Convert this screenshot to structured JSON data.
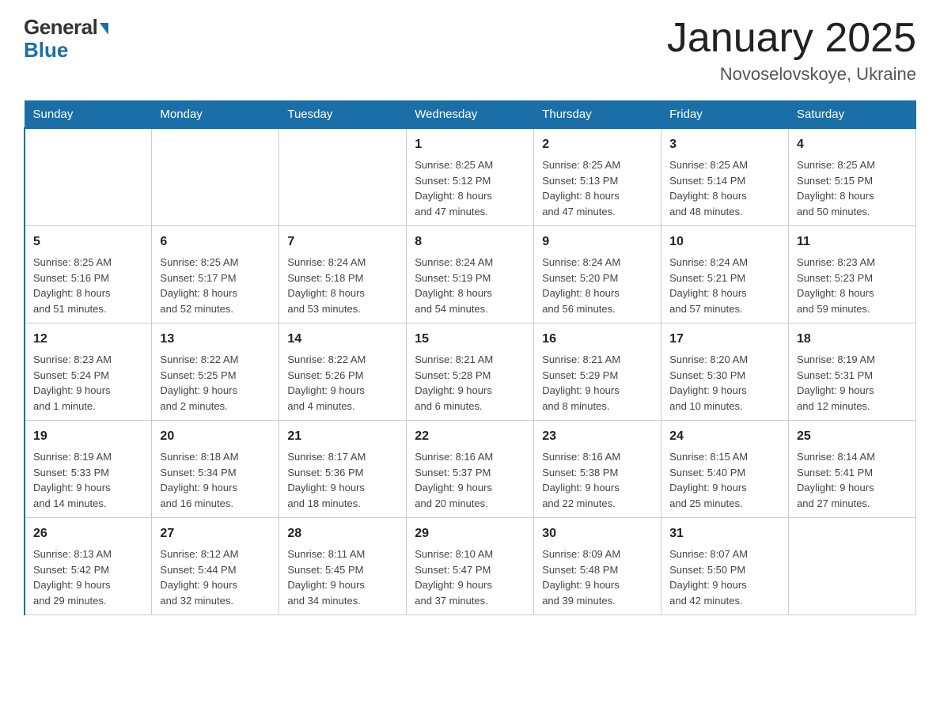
{
  "header": {
    "logo_general": "General",
    "logo_blue": "Blue",
    "title": "January 2025",
    "subtitle": "Novoselovskoye, Ukraine"
  },
  "days_of_week": [
    "Sunday",
    "Monday",
    "Tuesday",
    "Wednesday",
    "Thursday",
    "Friday",
    "Saturday"
  ],
  "weeks": [
    {
      "cells": [
        {
          "day": "",
          "info": ""
        },
        {
          "day": "",
          "info": ""
        },
        {
          "day": "",
          "info": ""
        },
        {
          "day": "1",
          "info": "Sunrise: 8:25 AM\nSunset: 5:12 PM\nDaylight: 8 hours\nand 47 minutes."
        },
        {
          "day": "2",
          "info": "Sunrise: 8:25 AM\nSunset: 5:13 PM\nDaylight: 8 hours\nand 47 minutes."
        },
        {
          "day": "3",
          "info": "Sunrise: 8:25 AM\nSunset: 5:14 PM\nDaylight: 8 hours\nand 48 minutes."
        },
        {
          "day": "4",
          "info": "Sunrise: 8:25 AM\nSunset: 5:15 PM\nDaylight: 8 hours\nand 50 minutes."
        }
      ]
    },
    {
      "cells": [
        {
          "day": "5",
          "info": "Sunrise: 8:25 AM\nSunset: 5:16 PM\nDaylight: 8 hours\nand 51 minutes."
        },
        {
          "day": "6",
          "info": "Sunrise: 8:25 AM\nSunset: 5:17 PM\nDaylight: 8 hours\nand 52 minutes."
        },
        {
          "day": "7",
          "info": "Sunrise: 8:24 AM\nSunset: 5:18 PM\nDaylight: 8 hours\nand 53 minutes."
        },
        {
          "day": "8",
          "info": "Sunrise: 8:24 AM\nSunset: 5:19 PM\nDaylight: 8 hours\nand 54 minutes."
        },
        {
          "day": "9",
          "info": "Sunrise: 8:24 AM\nSunset: 5:20 PM\nDaylight: 8 hours\nand 56 minutes."
        },
        {
          "day": "10",
          "info": "Sunrise: 8:24 AM\nSunset: 5:21 PM\nDaylight: 8 hours\nand 57 minutes."
        },
        {
          "day": "11",
          "info": "Sunrise: 8:23 AM\nSunset: 5:23 PM\nDaylight: 8 hours\nand 59 minutes."
        }
      ]
    },
    {
      "cells": [
        {
          "day": "12",
          "info": "Sunrise: 8:23 AM\nSunset: 5:24 PM\nDaylight: 9 hours\nand 1 minute."
        },
        {
          "day": "13",
          "info": "Sunrise: 8:22 AM\nSunset: 5:25 PM\nDaylight: 9 hours\nand 2 minutes."
        },
        {
          "day": "14",
          "info": "Sunrise: 8:22 AM\nSunset: 5:26 PM\nDaylight: 9 hours\nand 4 minutes."
        },
        {
          "day": "15",
          "info": "Sunrise: 8:21 AM\nSunset: 5:28 PM\nDaylight: 9 hours\nand 6 minutes."
        },
        {
          "day": "16",
          "info": "Sunrise: 8:21 AM\nSunset: 5:29 PM\nDaylight: 9 hours\nand 8 minutes."
        },
        {
          "day": "17",
          "info": "Sunrise: 8:20 AM\nSunset: 5:30 PM\nDaylight: 9 hours\nand 10 minutes."
        },
        {
          "day": "18",
          "info": "Sunrise: 8:19 AM\nSunset: 5:31 PM\nDaylight: 9 hours\nand 12 minutes."
        }
      ]
    },
    {
      "cells": [
        {
          "day": "19",
          "info": "Sunrise: 8:19 AM\nSunset: 5:33 PM\nDaylight: 9 hours\nand 14 minutes."
        },
        {
          "day": "20",
          "info": "Sunrise: 8:18 AM\nSunset: 5:34 PM\nDaylight: 9 hours\nand 16 minutes."
        },
        {
          "day": "21",
          "info": "Sunrise: 8:17 AM\nSunset: 5:36 PM\nDaylight: 9 hours\nand 18 minutes."
        },
        {
          "day": "22",
          "info": "Sunrise: 8:16 AM\nSunset: 5:37 PM\nDaylight: 9 hours\nand 20 minutes."
        },
        {
          "day": "23",
          "info": "Sunrise: 8:16 AM\nSunset: 5:38 PM\nDaylight: 9 hours\nand 22 minutes."
        },
        {
          "day": "24",
          "info": "Sunrise: 8:15 AM\nSunset: 5:40 PM\nDaylight: 9 hours\nand 25 minutes."
        },
        {
          "day": "25",
          "info": "Sunrise: 8:14 AM\nSunset: 5:41 PM\nDaylight: 9 hours\nand 27 minutes."
        }
      ]
    },
    {
      "cells": [
        {
          "day": "26",
          "info": "Sunrise: 8:13 AM\nSunset: 5:42 PM\nDaylight: 9 hours\nand 29 minutes."
        },
        {
          "day": "27",
          "info": "Sunrise: 8:12 AM\nSunset: 5:44 PM\nDaylight: 9 hours\nand 32 minutes."
        },
        {
          "day": "28",
          "info": "Sunrise: 8:11 AM\nSunset: 5:45 PM\nDaylight: 9 hours\nand 34 minutes."
        },
        {
          "day": "29",
          "info": "Sunrise: 8:10 AM\nSunset: 5:47 PM\nDaylight: 9 hours\nand 37 minutes."
        },
        {
          "day": "30",
          "info": "Sunrise: 8:09 AM\nSunset: 5:48 PM\nDaylight: 9 hours\nand 39 minutes."
        },
        {
          "day": "31",
          "info": "Sunrise: 8:07 AM\nSunset: 5:50 PM\nDaylight: 9 hours\nand 42 minutes."
        },
        {
          "day": "",
          "info": ""
        }
      ]
    }
  ]
}
